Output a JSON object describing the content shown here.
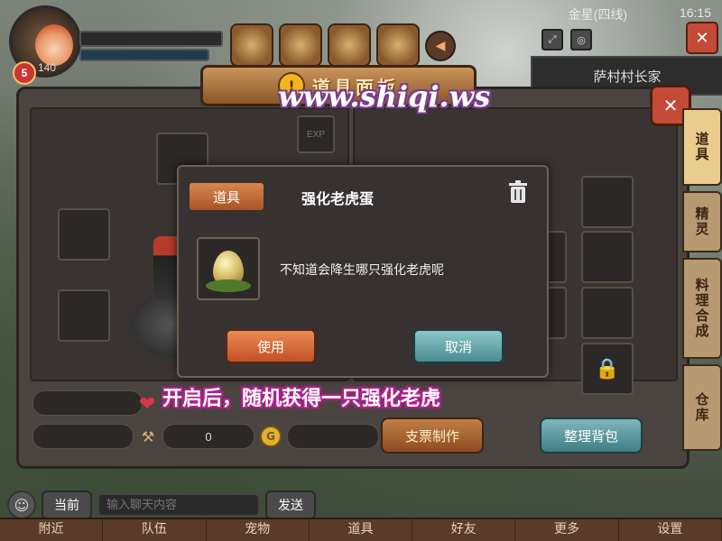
{
  "hud": {
    "level_badge": "5",
    "level_value": "140",
    "server": "金星(四线)",
    "clock": "16:15",
    "location": "萨村村长家",
    "close_icon": "✕"
  },
  "panel": {
    "title": "道具面板",
    "title_badge": "!",
    "watermark": "www.shiqi.ws",
    "close_icon": "✕",
    "exp_slot_label": "EXP",
    "side_tabs": [
      {
        "label": "道具"
      },
      {
        "label": "精灵"
      },
      {
        "label": "料理合成"
      },
      {
        "label": "仓库"
      }
    ],
    "stats": {
      "hammer_value": "0"
    },
    "btn_ticket": "支票制作",
    "btn_sort": "整理背包"
  },
  "modal": {
    "tag": "道具",
    "title": "强化老虎蛋",
    "description": "不知道会降生哪只强化老虎呢",
    "use_label": "使用",
    "cancel_label": "取消"
  },
  "caption": "开启后，随机获得一只强化老虎",
  "chat": {
    "current_label": "当前",
    "input_placeholder": "输入聊天内容",
    "send_label": "发送"
  },
  "nav": [
    "附近",
    "队伍",
    "宠物",
    "道具",
    "好友",
    "更多",
    "设置"
  ],
  "colors": {
    "accent_orange": "#c25126",
    "accent_teal": "#4a8c91",
    "caption_glow": "#b0208c"
  }
}
